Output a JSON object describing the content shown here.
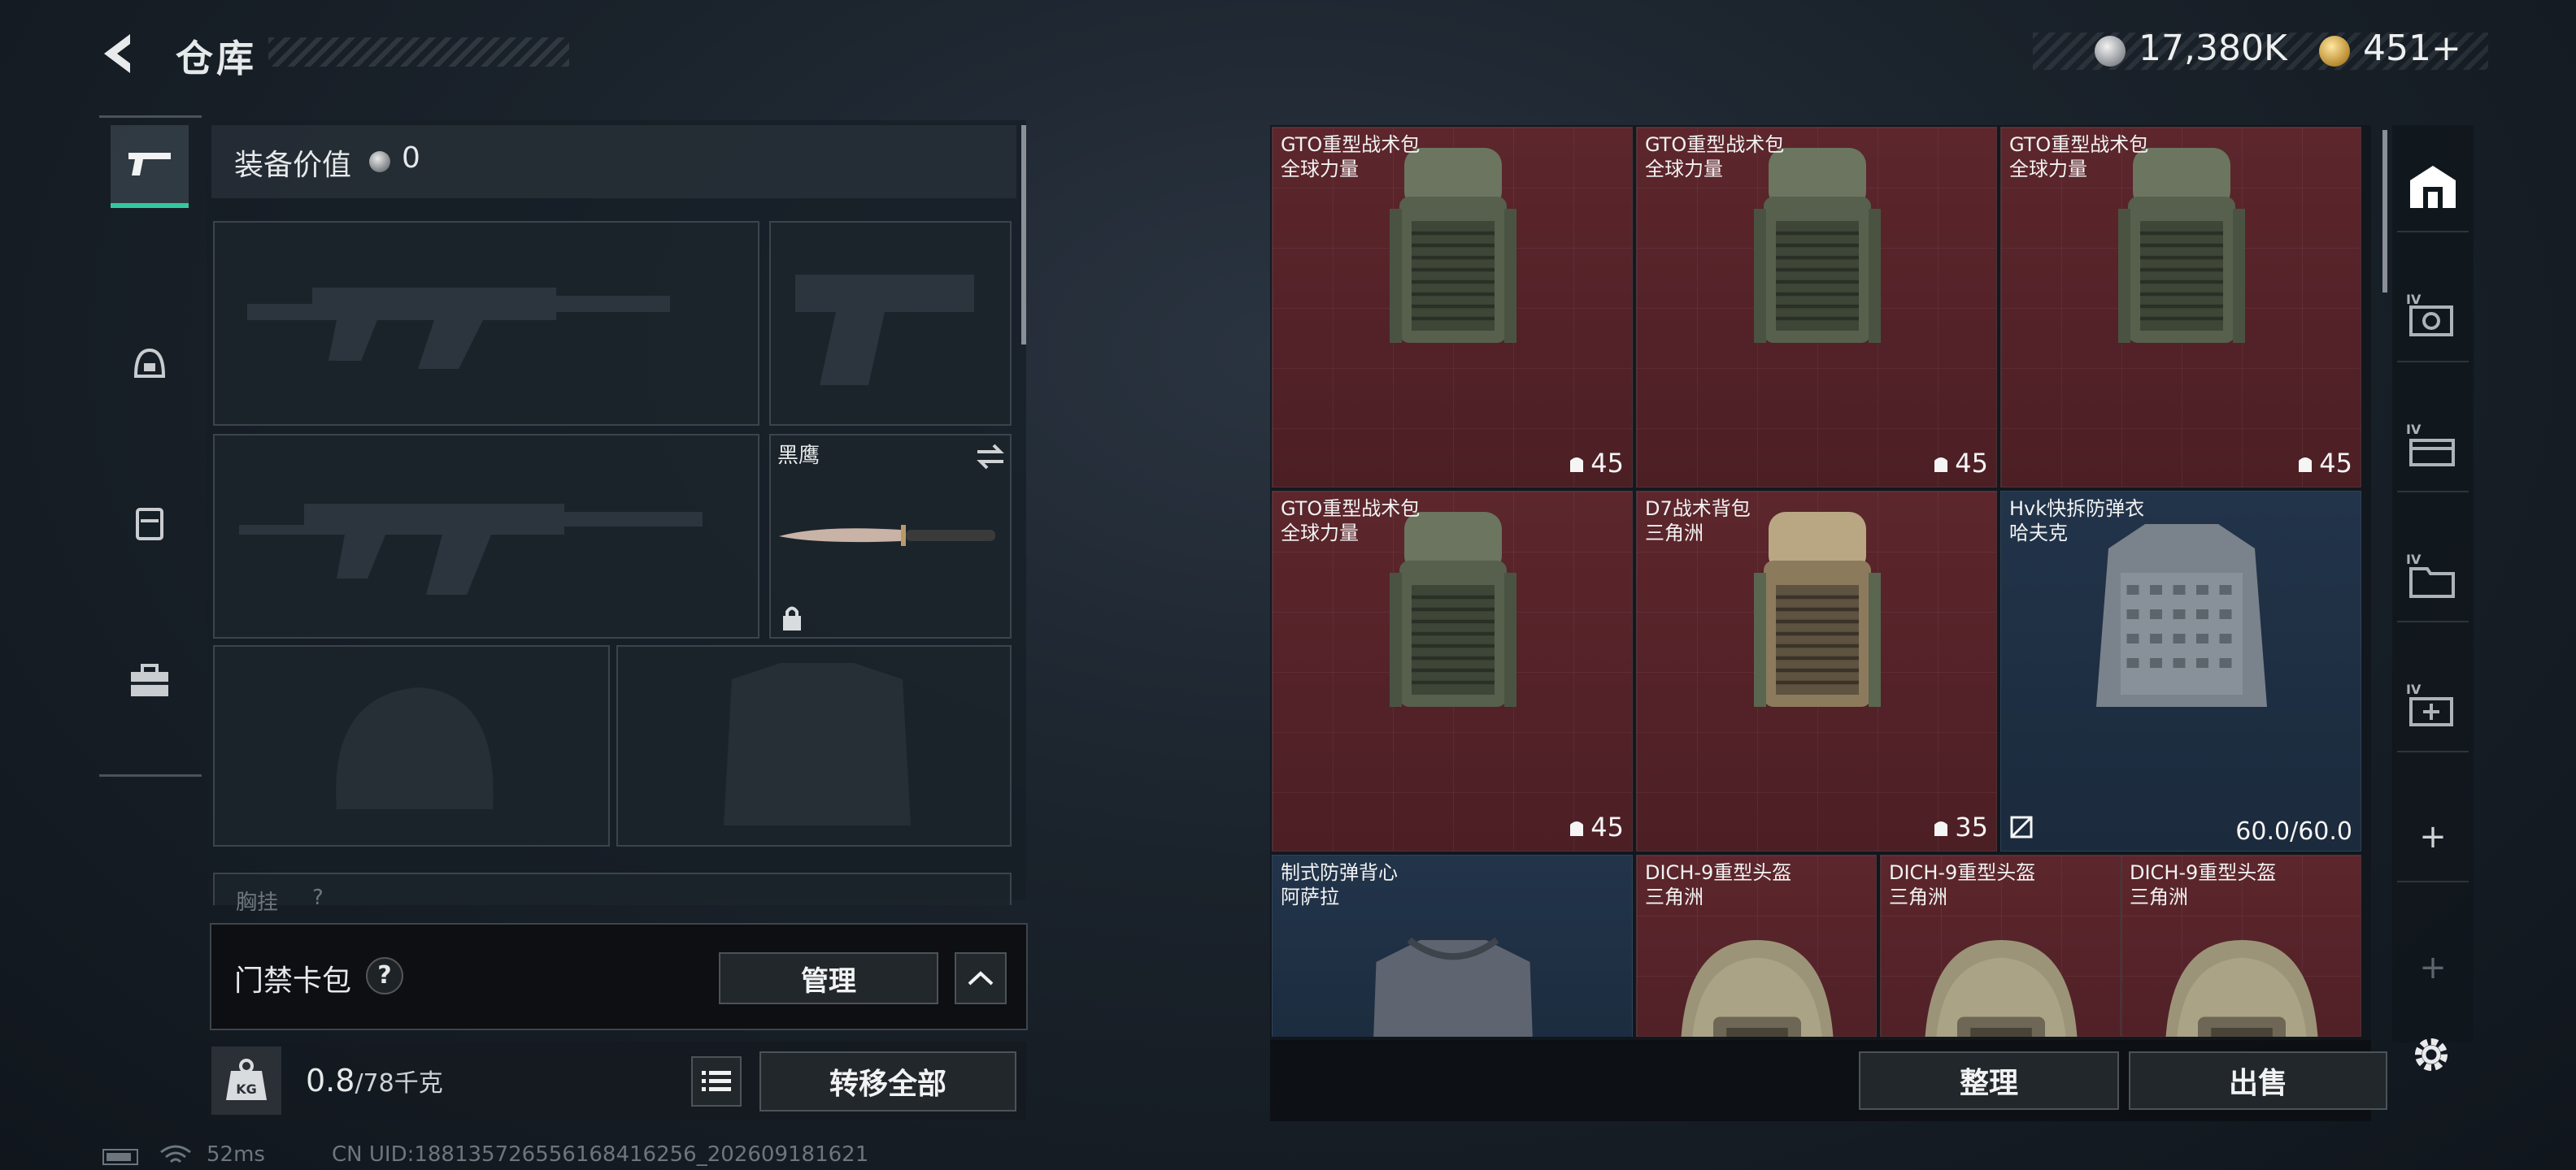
{
  "header": {
    "title": "仓库",
    "currency_silver": "17,380K",
    "currency_gold": "451+"
  },
  "equipment": {
    "value_label": "装备价值",
    "value": "0",
    "melee_name": "黑鹰",
    "chest_rig_label": "胸挂",
    "chest_rig_help": "?"
  },
  "access_card": {
    "label": "门禁卡包",
    "help": "?",
    "manage_label": "管理"
  },
  "weight": {
    "current": "0.8",
    "max": "/78千克",
    "transfer_all_label": "转移全部"
  },
  "status_bar": {
    "ping": "52ms",
    "uid": "CN UID:188135726556168416256_202609181621"
  },
  "storage": {
    "items": [
      {
        "name": "GTO重型战术包",
        "source": "全球力量",
        "capacity": "45",
        "style": "red",
        "kind": "backpack-green"
      },
      {
        "name": "GTO重型战术包",
        "source": "全球力量",
        "capacity": "45",
        "style": "red",
        "kind": "backpack-green"
      },
      {
        "name": "GTO重型战术包",
        "source": "全球力量",
        "capacity": "45",
        "style": "red",
        "kind": "backpack-green"
      },
      {
        "name": "GTO重型战术包",
        "source": "全球力量",
        "capacity": "45",
        "style": "red",
        "kind": "backpack-green"
      },
      {
        "name": "D7战术背包",
        "source": "三角洲",
        "capacity": "35",
        "style": "red",
        "kind": "backpack-tan"
      },
      {
        "name": "Hvk快拆防弹衣",
        "source": "哈夫克",
        "durability": "60.0/60.0",
        "style": "blue",
        "kind": "vest"
      },
      {
        "name": "制式防弹背心",
        "source": "阿萨拉",
        "style": "blue",
        "kind": "vest-plain"
      },
      {
        "name": "DICH-9重型头盔",
        "source": "三角洲",
        "style": "red",
        "kind": "helmet"
      },
      {
        "name": "DICH-9重型头盔",
        "source": "三角洲",
        "style": "red",
        "kind": "helmet"
      },
      {
        "name": "DICH-9重型头盔",
        "source": "三角洲",
        "style": "red",
        "kind": "helmet"
      }
    ],
    "tidy_label": "整理",
    "sell_label": "出售"
  },
  "right_rail": {
    "plus_1": "+",
    "plus_2": "+"
  }
}
